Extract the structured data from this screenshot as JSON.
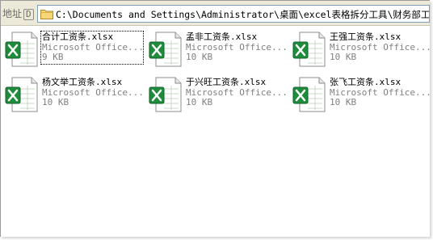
{
  "address_bar": {
    "label": "地址",
    "accelerator": "D",
    "path": "C:\\Documents and Settings\\Administrator\\桌面\\excel表格拆分工具\\财务部工资表"
  },
  "files": [
    {
      "name": "合计工资条.xlsx",
      "type": "Microsoft Office...",
      "size": "9 KB"
    },
    {
      "name": "孟非工资条.xlsx",
      "type": "Microsoft Office...",
      "size": "10 KB"
    },
    {
      "name": "王强工资条.xlsx",
      "type": "Microsoft Office...",
      "size": "10 KB"
    },
    {
      "name": "杨文举工资条.xlsx",
      "type": "Microsoft Office...",
      "size": "10 KB"
    },
    {
      "name": "于兴旺工资条.xlsx",
      "type": "Microsoft Office...",
      "size": "10 KB"
    },
    {
      "name": "张飞工资条.xlsx",
      "type": "Microsoft Office...",
      "size": "10 KB"
    }
  ],
  "icons": {
    "file": "excel-file-icon",
    "folder": "folder-icon"
  },
  "colors": {
    "excel_green": "#1f8c3b",
    "toolbar": "#ece9d8",
    "field_border": "#7f9db9",
    "secondary_text": "#808080"
  }
}
